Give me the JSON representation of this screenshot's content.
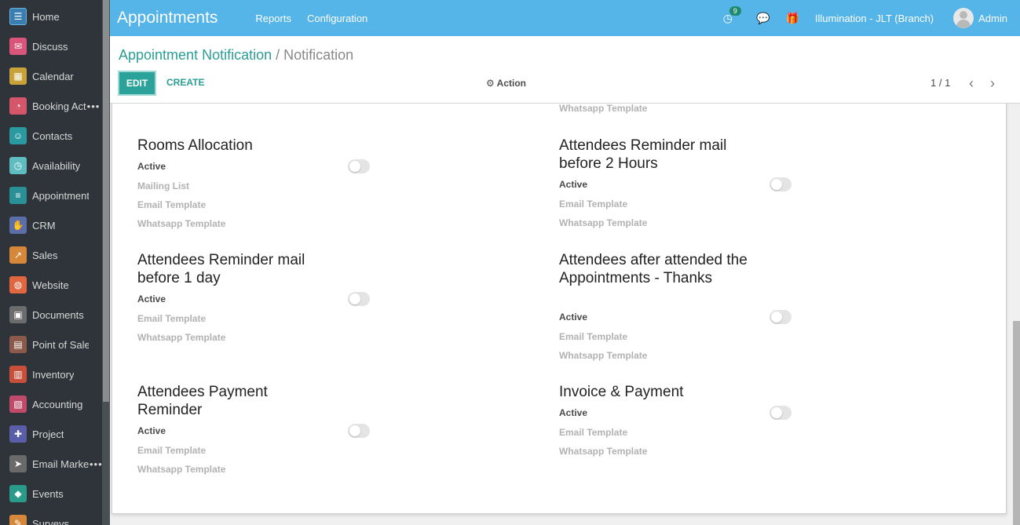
{
  "sidebar": {
    "items": [
      {
        "label": "Home",
        "icon": "home-icon",
        "color": "#5aa8d6",
        "glyph": "☰",
        "truncated": false
      },
      {
        "label": "Discuss",
        "icon": "discuss-icon",
        "color": "#d9567a",
        "glyph": "✉",
        "truncated": false
      },
      {
        "label": "Calendar",
        "icon": "calendar-icon",
        "color": "#c9a23a",
        "glyph": "▦",
        "truncated": false
      },
      {
        "label": "Booking Act",
        "icon": "booking-icon",
        "color": "#d5566a",
        "glyph": "◔",
        "truncated": true
      },
      {
        "label": "Contacts",
        "icon": "contacts-icon",
        "color": "#2a9aa0",
        "glyph": "☺",
        "truncated": false
      },
      {
        "label": "Availability",
        "icon": "availability-icon",
        "color": "#5fbcc0",
        "glyph": "◷",
        "truncated": false
      },
      {
        "label": "Appointments",
        "icon": "appointments-icon",
        "color": "#2a8f96",
        "glyph": "≡",
        "truncated": false
      },
      {
        "label": "CRM",
        "icon": "crm-icon",
        "color": "#5b6ea8",
        "glyph": "✋",
        "truncated": false
      },
      {
        "label": "Sales",
        "icon": "sales-icon",
        "color": "#d5873a",
        "glyph": "↗",
        "truncated": false
      },
      {
        "label": "Website",
        "icon": "website-icon",
        "color": "#e0673f",
        "glyph": "◍",
        "truncated": false
      },
      {
        "label": "Documents",
        "icon": "documents-icon",
        "color": "#6c6c6c",
        "glyph": "▣",
        "truncated": false
      },
      {
        "label": "Point of Sale",
        "icon": "pos-icon",
        "color": "#8b5a4a",
        "glyph": "▤",
        "truncated": false
      },
      {
        "label": "Inventory",
        "icon": "inventory-icon",
        "color": "#c8503a",
        "glyph": "▥",
        "truncated": false
      },
      {
        "label": "Accounting",
        "icon": "accounting-icon",
        "color": "#c04a6a",
        "glyph": "▧",
        "truncated": false
      },
      {
        "label": "Project",
        "icon": "project-icon",
        "color": "#5a5ea8",
        "glyph": "✚",
        "truncated": false
      },
      {
        "label": "Email Marke",
        "icon": "email-marketing-icon",
        "color": "#6a6a6a",
        "glyph": "➤",
        "truncated": true
      },
      {
        "label": "Events",
        "icon": "events-icon",
        "color": "#2a9a8a",
        "glyph": "◆",
        "truncated": false
      },
      {
        "label": "Surveys",
        "icon": "surveys-icon",
        "color": "#d5873a",
        "glyph": "✎",
        "truncated": false
      }
    ],
    "ellipsis": "•••"
  },
  "topbar": {
    "app_title": "Appointments",
    "links": [
      "Reports",
      "Configuration"
    ],
    "activity_count": "9",
    "company": "Illumination - JLT (Branch)",
    "user": "Admin",
    "accent_color": "#55b4e8"
  },
  "control": {
    "breadcrumb_parent": "Appointment Notification",
    "breadcrumb_sep": "/",
    "breadcrumb_current": "Notification",
    "edit_label": "EDIT",
    "create_label": "CREATE",
    "action_label": "Action",
    "pager": "1 / 1"
  },
  "form": {
    "top_partial": "Whatsapp Template",
    "sections": [
      {
        "title": "Rooms Allocation",
        "active_label": "Active",
        "active": false,
        "fields": [
          "Mailing List",
          "Email Template",
          "Whatsapp Template"
        ]
      },
      {
        "title": "Attendees Reminder mail before 2 Hours",
        "active_label": "Active",
        "active": false,
        "fields": [
          "Email Template",
          "Whatsapp Template"
        ]
      },
      {
        "title": "Attendees Reminder mail before 1 day",
        "active_label": "Active",
        "active": false,
        "fields": [
          "Email Template",
          "Whatsapp Template"
        ]
      },
      {
        "title": "Attendees after attended the Appointments - Thanks",
        "active_label": "Active",
        "active": false,
        "fields": [
          "Email Template",
          "Whatsapp Template"
        ]
      },
      {
        "title": "Attendees Payment Reminder",
        "active_label": "Active",
        "active": false,
        "fields": [
          "Email Template",
          "Whatsapp Template"
        ]
      },
      {
        "title": "Invoice & Payment",
        "active_label": "Active",
        "active": false,
        "fields": [
          "Email Template",
          "Whatsapp Template"
        ]
      }
    ]
  }
}
